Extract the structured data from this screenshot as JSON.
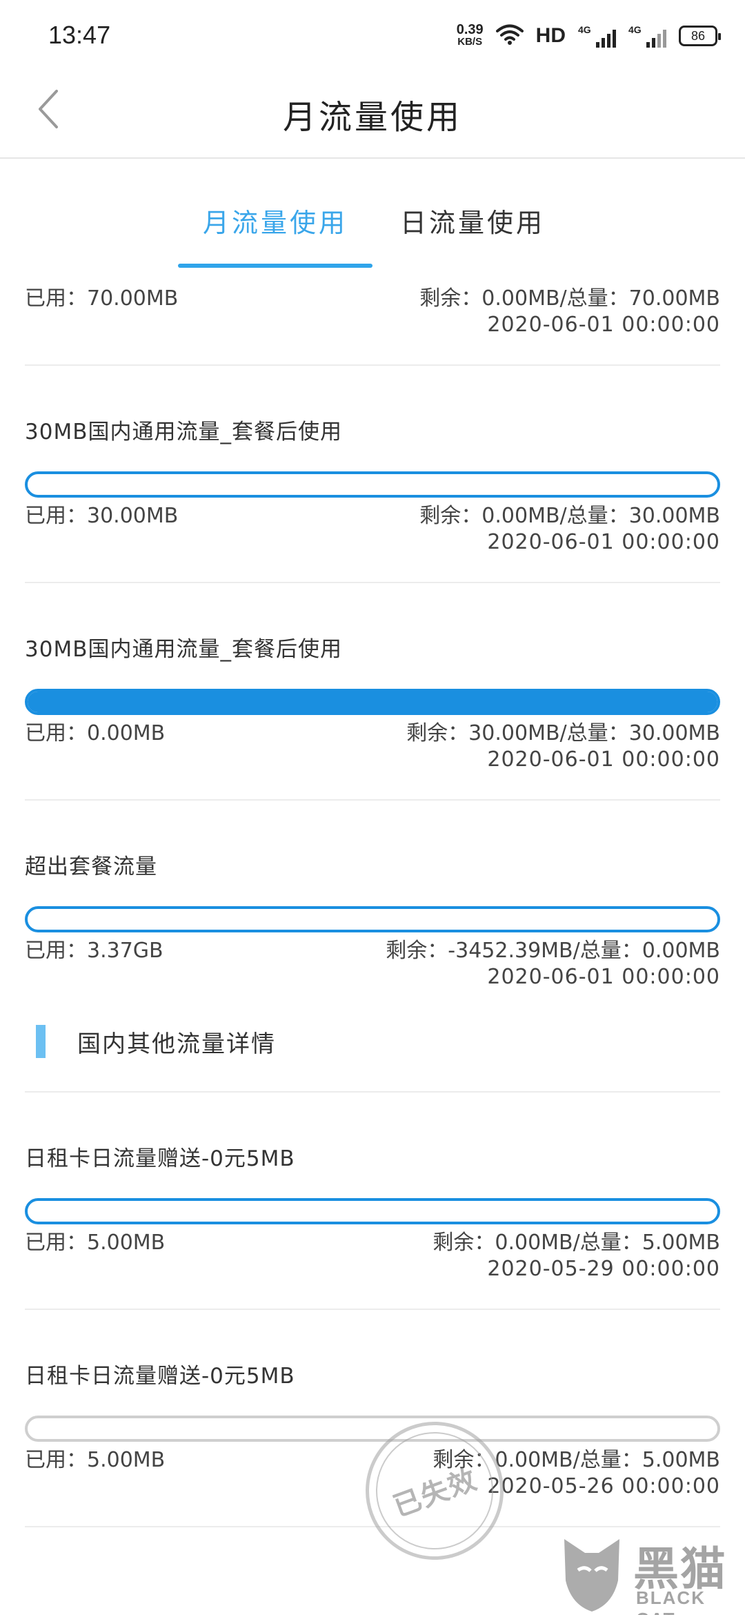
{
  "status_bar": {
    "time": "13:47",
    "speed_value": "0.39",
    "speed_unit": "KB/S",
    "hd": "HD",
    "sim1": "4G",
    "sim2": "4G",
    "battery": "86"
  },
  "header": {
    "title": "月流量使用"
  },
  "tabs": [
    {
      "label": "月流量使用",
      "active": true
    },
    {
      "label": "日流量使用",
      "active": false
    }
  ],
  "top_partial": {
    "used": "已用：70.00MB",
    "remaining": "剩余：0.00MB/总量：70.00MB",
    "date": "2020-06-01  00:00:00"
  },
  "packages": [
    {
      "title": "30MB国内通用流量_套餐后使用",
      "used": "已用：30.00MB",
      "remaining": "剩余：0.00MB/总量：30.00MB",
      "date": "2020-06-01  00:00:00",
      "remaining_fraction": 0
    },
    {
      "title": "30MB国内通用流量_套餐后使用",
      "used": "已用：0.00MB",
      "remaining": "剩余：30.00MB/总量：30.00MB",
      "date": "2020-06-01  00:00:00",
      "remaining_fraction": 1
    },
    {
      "title": "超出套餐流量",
      "used": "已用：3.37GB",
      "remaining": "剩余：-3452.39MB/总量：0.00MB",
      "date": "2020-06-01  00:00:00",
      "remaining_fraction": 0
    }
  ],
  "section": {
    "title": "国内其他流量详情"
  },
  "other_packages": [
    {
      "title": "日租卡日流量赠送-0元5MB",
      "used": "已用：5.00MB",
      "remaining": "剩余：0.00MB/总量：5.00MB",
      "date": "2020-05-29  00:00:00",
      "remaining_fraction": 0
    },
    {
      "title": "日租卡日流量赠送-0元5MB",
      "used": "已用：5.00MB",
      "remaining": "剩余：0.00MB/总量：5.00MB",
      "date": "2020-05-26  00:00:00",
      "remaining_fraction": 0
    }
  ],
  "stamp": "已失效",
  "watermark": {
    "cn": "黑猫",
    "en": "BLACK CAT"
  },
  "colors": {
    "accent": "#3aa6ea",
    "bar": "#1a8fe0",
    "bar_expired": "#cfcfcf",
    "section_mark": "#6cc0f2"
  },
  "icons": [
    "back-chevron-icon",
    "wifi-icon",
    "signal-icon",
    "battery-icon"
  ]
}
